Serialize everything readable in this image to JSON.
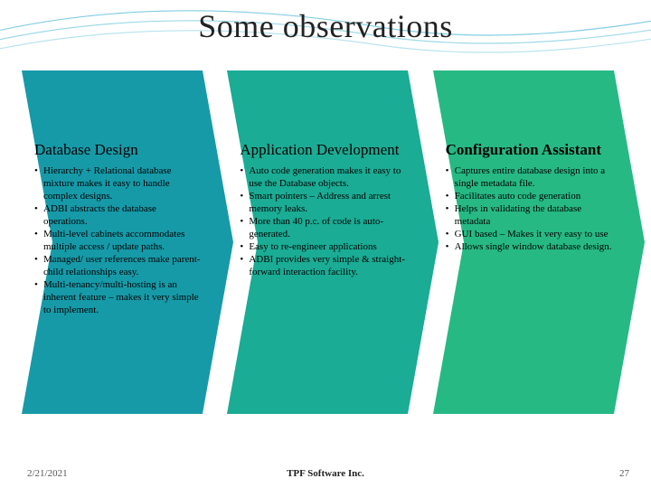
{
  "title": "Some observations",
  "columns": [
    {
      "color": "#169aa8",
      "heading": "Database Design",
      "heading_bold": false,
      "bullets": [
        "Hierarchy + Relational database mixture makes it easy to handle complex designs.",
        "ADBI abstracts the database operations.",
        "Multi-level cabinets accommodates multiple access / update paths.",
        "Managed/ user references make parent-child relationships easy.",
        "Multi-tenancy/multi-hosting is an inherent feature – makes it very simple to implement."
      ]
    },
    {
      "color": "#1aac94",
      "heading": "Application Development",
      "heading_bold": false,
      "bullets": [
        "Auto code generation makes it easy to use the Database objects.",
        "Smart pointers – Address and arrest memory leaks.",
        "More than 40 p.c. of code is auto-generated.",
        "Easy to re-engineer applications",
        "ADBI provides very simple & straight-forward interaction facility."
      ]
    },
    {
      "color": "#26b984",
      "heading": "Configuration Assistant",
      "heading_bold": true,
      "bullets": [
        "Captures entire database design into a single metadata file.",
        "Facilitates auto code generation",
        "Helps in validating the database metadata",
        "GUI based – Makes it very easy to use",
        "Allows single window database design."
      ]
    }
  ],
  "footer": {
    "date": "2/21/2021",
    "center": "TPF Software Inc.",
    "page": "27"
  }
}
